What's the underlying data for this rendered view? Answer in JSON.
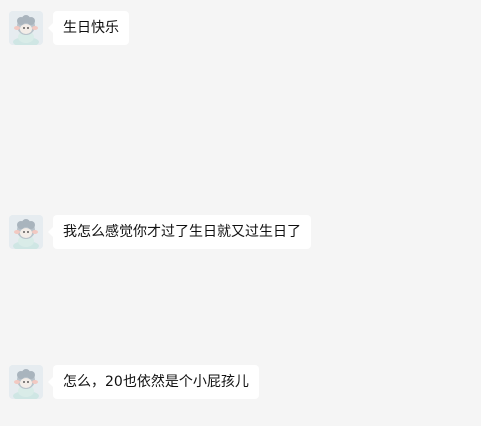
{
  "chat": {
    "messages": [
      {
        "sender_avatar": "cute-sheep-avatar",
        "text": "生日快乐"
      },
      {
        "sender_avatar": "cute-sheep-avatar",
        "text": "我怎么感觉你才过了生日就又过生日了"
      },
      {
        "sender_avatar": "cute-sheep-avatar",
        "text": "怎么，20也依然是个小屁孩儿"
      }
    ]
  },
  "colors": {
    "background": "#f5f5f5",
    "bubble": "#ffffff",
    "text": "#111111"
  }
}
